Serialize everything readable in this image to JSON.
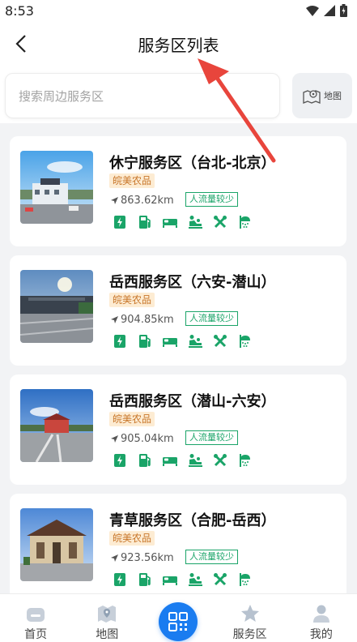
{
  "status_bar": {
    "time": "8:53",
    "icons": [
      "wifi-icon",
      "signal-icon",
      "battery-icon"
    ]
  },
  "header": {
    "title": "服务区列表",
    "back_icon": "chevron-left-icon"
  },
  "search": {
    "placeholder": "搜索周边服务区",
    "value": "",
    "map_button_label": "地图"
  },
  "colors": {
    "accent_green": "#1aa468",
    "tag_bg": "#fdecd3",
    "tag_text": "#c8762a",
    "scan_blue": "#1a7cf0",
    "annotation_red": "#e8453c"
  },
  "service_areas": [
    {
      "name": "休宁服务区（台北-北京）",
      "tag": "皖美农品",
      "distance": "863.62km",
      "traffic": "人流量较少"
    },
    {
      "name": "岳西服务区（六安-潜山）",
      "tag": "皖美农品",
      "distance": "904.85km",
      "traffic": "人流量较少"
    },
    {
      "name": "岳西服务区（潜山-六安）",
      "tag": "皖美农品",
      "distance": "905.04km",
      "traffic": "人流量较少"
    },
    {
      "name": "青草服务区（合肥-岳西）",
      "tag": "皖美农品",
      "distance": "923.56km",
      "traffic": "人流量较少"
    }
  ],
  "facility_icons": [
    "charging-icon",
    "fuel-icon",
    "bed-icon",
    "baby-care-icon",
    "repair-icon",
    "shower-icon"
  ],
  "bottom_nav": [
    {
      "label": "首页",
      "icon": "home-icon"
    },
    {
      "label": "地图",
      "icon": "map-icon"
    },
    {
      "label": "",
      "icon": "qr-scan-icon"
    },
    {
      "label": "服务区",
      "icon": "star-icon"
    },
    {
      "label": "我的",
      "icon": "user-icon"
    }
  ]
}
